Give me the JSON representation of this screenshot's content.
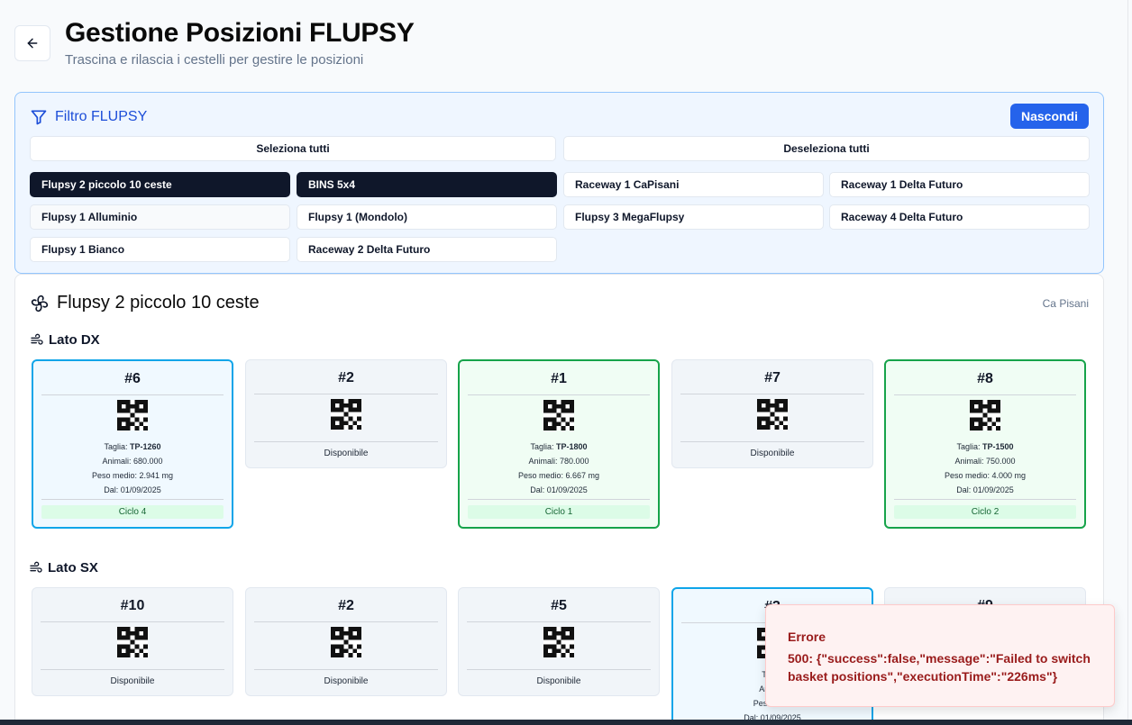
{
  "header": {
    "title": "Gestione Posizioni FLUPSY",
    "subtitle": "Trascina e rilascia i cestelli per gestire le posizioni"
  },
  "filter": {
    "title": "Filtro FLUPSY",
    "hide_label": "Nascondi",
    "select_all": "Seleziona tutti",
    "deselect_all": "Deseleziona tutti",
    "chips": [
      {
        "label": "Flupsy 2 piccolo 10 ceste",
        "selected": true
      },
      {
        "label": "BINS 5x4",
        "selected": true
      },
      {
        "label": "Raceway 1 CaPisani",
        "selected": false
      },
      {
        "label": "Raceway 1 Delta Futuro",
        "selected": false
      },
      {
        "label": "Flupsy 1 Alluminio",
        "selected": false
      },
      {
        "label": "Flupsy 1 (Mondolo)",
        "selected": false
      },
      {
        "label": "Flupsy 3 MegaFlupsy",
        "selected": false
      },
      {
        "label": "Raceway 4 Delta Futuro",
        "selected": false
      },
      {
        "label": "Flupsy 1 Bianco",
        "selected": false
      },
      {
        "label": "Raceway 2 Delta Futuro",
        "selected": false
      }
    ]
  },
  "flupsy": {
    "name": "Flupsy 2 piccolo 10 ceste",
    "location": "Ca Pisani",
    "lato_dx": {
      "label": "Lato DX",
      "baskets": [
        {
          "num": "#6",
          "taglia_label": "Taglia: ",
          "taglia": "TP-1260",
          "animali": "Animali: 680.000",
          "peso_label": "Peso medio: ",
          "peso": "2.941 mg",
          "dal": "Dal: 01/09/2025",
          "ciclo": "Ciclo 4"
        },
        {
          "num": "#2",
          "status": "Disponibile"
        },
        {
          "num": "#1",
          "taglia_label": "Taglia: ",
          "taglia": "TP-1800",
          "animali": "Animali: 780.000",
          "peso_label": "Peso medio: ",
          "peso": "6.667 mg",
          "dal": "Dal: 01/09/2025",
          "ciclo": "Ciclo 1"
        },
        {
          "num": "#7",
          "status": "Disponibile"
        },
        {
          "num": "#8",
          "taglia_label": "Taglia: ",
          "taglia": "TP-1500",
          "animali": "Animali: 750.000",
          "peso_label": "Peso medio: ",
          "peso": "4.000 mg",
          "dal": "Dal: 01/09/2025",
          "ciclo": "Ciclo 2"
        }
      ]
    },
    "lato_sx": {
      "label": "Lato SX",
      "baskets": [
        {
          "num": "#10",
          "status": "Disponibile"
        },
        {
          "num": "#2",
          "status": "Disponibile"
        },
        {
          "num": "#5",
          "status": "Disponibile"
        },
        {
          "num": "#3",
          "taglia_label": "Taglia",
          "animali": "Animali",
          "peso_label": "Peso medi",
          "dal": "Dal: 01/09/2025"
        },
        {
          "num": "#9"
        }
      ]
    }
  },
  "toast": {
    "title": "Errore",
    "message": "500: {\"success\":false,\"message\":\"Failed to switch basket positions\",\"executionTime\":\"226ms\"}"
  },
  "colors": {
    "accent": "#2563eb",
    "active_chip": "#0f172a",
    "blue_border": "#0ea5e9",
    "green_border": "#16a34a",
    "error": "#991b1b"
  }
}
